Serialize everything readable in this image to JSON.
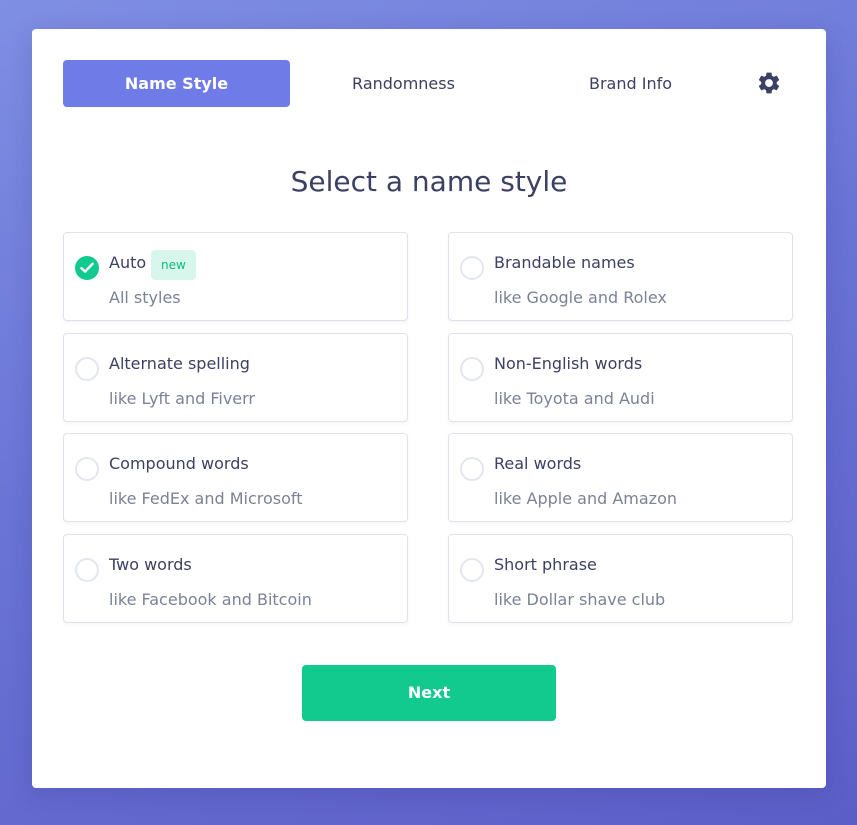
{
  "tabs": [
    {
      "label": "Name Style",
      "active": true
    },
    {
      "label": "Randomness",
      "active": false
    },
    {
      "label": "Brand Info",
      "active": false
    }
  ],
  "settings_icon": "gear-icon",
  "title": "Select a name style",
  "options": [
    {
      "label": "Auto",
      "desc": "All styles",
      "badge": "new",
      "selected": true
    },
    {
      "label": "Brandable names",
      "desc": "like Google and Rolex",
      "selected": false
    },
    {
      "label": "Alternate spelling",
      "desc": "like Lyft and Fiverr",
      "selected": false
    },
    {
      "label": "Non-English words",
      "desc": "like Toyota and Audi",
      "selected": false
    },
    {
      "label": "Compound words",
      "desc": "like FedEx and Microsoft",
      "selected": false
    },
    {
      "label": "Real words",
      "desc": "like Apple and Amazon",
      "selected": false
    },
    {
      "label": "Two words",
      "desc": "like Facebook and Bitcoin",
      "selected": false
    },
    {
      "label": "Short phrase",
      "desc": "like Dollar shave club",
      "selected": false
    }
  ],
  "next_label": "Next",
  "colors": {
    "primary": "#6f7be6",
    "accent": "#12c98e",
    "text": "#3c4063",
    "muted": "#7a8296"
  }
}
